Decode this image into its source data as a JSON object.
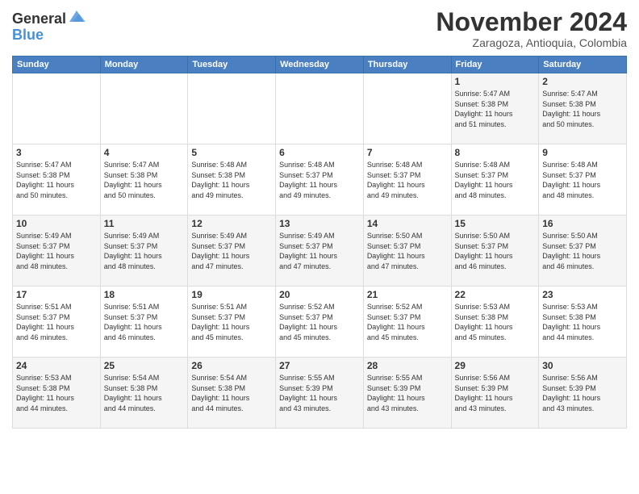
{
  "logo": {
    "line1": "General",
    "line2": "Blue"
  },
  "title": "November 2024",
  "location": "Zaragoza, Antioquia, Colombia",
  "weekdays": [
    "Sunday",
    "Monday",
    "Tuesday",
    "Wednesday",
    "Thursday",
    "Friday",
    "Saturday"
  ],
  "weeks": [
    [
      {
        "day": "",
        "info": ""
      },
      {
        "day": "",
        "info": ""
      },
      {
        "day": "",
        "info": ""
      },
      {
        "day": "",
        "info": ""
      },
      {
        "day": "",
        "info": ""
      },
      {
        "day": "1",
        "info": "Sunrise: 5:47 AM\nSunset: 5:38 PM\nDaylight: 11 hours\nand 51 minutes."
      },
      {
        "day": "2",
        "info": "Sunrise: 5:47 AM\nSunset: 5:38 PM\nDaylight: 11 hours\nand 50 minutes."
      }
    ],
    [
      {
        "day": "3",
        "info": "Sunrise: 5:47 AM\nSunset: 5:38 PM\nDaylight: 11 hours\nand 50 minutes."
      },
      {
        "day": "4",
        "info": "Sunrise: 5:47 AM\nSunset: 5:38 PM\nDaylight: 11 hours\nand 50 minutes."
      },
      {
        "day": "5",
        "info": "Sunrise: 5:48 AM\nSunset: 5:38 PM\nDaylight: 11 hours\nand 49 minutes."
      },
      {
        "day": "6",
        "info": "Sunrise: 5:48 AM\nSunset: 5:37 PM\nDaylight: 11 hours\nand 49 minutes."
      },
      {
        "day": "7",
        "info": "Sunrise: 5:48 AM\nSunset: 5:37 PM\nDaylight: 11 hours\nand 49 minutes."
      },
      {
        "day": "8",
        "info": "Sunrise: 5:48 AM\nSunset: 5:37 PM\nDaylight: 11 hours\nand 48 minutes."
      },
      {
        "day": "9",
        "info": "Sunrise: 5:48 AM\nSunset: 5:37 PM\nDaylight: 11 hours\nand 48 minutes."
      }
    ],
    [
      {
        "day": "10",
        "info": "Sunrise: 5:49 AM\nSunset: 5:37 PM\nDaylight: 11 hours\nand 48 minutes."
      },
      {
        "day": "11",
        "info": "Sunrise: 5:49 AM\nSunset: 5:37 PM\nDaylight: 11 hours\nand 48 minutes."
      },
      {
        "day": "12",
        "info": "Sunrise: 5:49 AM\nSunset: 5:37 PM\nDaylight: 11 hours\nand 47 minutes."
      },
      {
        "day": "13",
        "info": "Sunrise: 5:49 AM\nSunset: 5:37 PM\nDaylight: 11 hours\nand 47 minutes."
      },
      {
        "day": "14",
        "info": "Sunrise: 5:50 AM\nSunset: 5:37 PM\nDaylight: 11 hours\nand 47 minutes."
      },
      {
        "day": "15",
        "info": "Sunrise: 5:50 AM\nSunset: 5:37 PM\nDaylight: 11 hours\nand 46 minutes."
      },
      {
        "day": "16",
        "info": "Sunrise: 5:50 AM\nSunset: 5:37 PM\nDaylight: 11 hours\nand 46 minutes."
      }
    ],
    [
      {
        "day": "17",
        "info": "Sunrise: 5:51 AM\nSunset: 5:37 PM\nDaylight: 11 hours\nand 46 minutes."
      },
      {
        "day": "18",
        "info": "Sunrise: 5:51 AM\nSunset: 5:37 PM\nDaylight: 11 hours\nand 46 minutes."
      },
      {
        "day": "19",
        "info": "Sunrise: 5:51 AM\nSunset: 5:37 PM\nDaylight: 11 hours\nand 45 minutes."
      },
      {
        "day": "20",
        "info": "Sunrise: 5:52 AM\nSunset: 5:37 PM\nDaylight: 11 hours\nand 45 minutes."
      },
      {
        "day": "21",
        "info": "Sunrise: 5:52 AM\nSunset: 5:37 PM\nDaylight: 11 hours\nand 45 minutes."
      },
      {
        "day": "22",
        "info": "Sunrise: 5:53 AM\nSunset: 5:38 PM\nDaylight: 11 hours\nand 45 minutes."
      },
      {
        "day": "23",
        "info": "Sunrise: 5:53 AM\nSunset: 5:38 PM\nDaylight: 11 hours\nand 44 minutes."
      }
    ],
    [
      {
        "day": "24",
        "info": "Sunrise: 5:53 AM\nSunset: 5:38 PM\nDaylight: 11 hours\nand 44 minutes."
      },
      {
        "day": "25",
        "info": "Sunrise: 5:54 AM\nSunset: 5:38 PM\nDaylight: 11 hours\nand 44 minutes."
      },
      {
        "day": "26",
        "info": "Sunrise: 5:54 AM\nSunset: 5:38 PM\nDaylight: 11 hours\nand 44 minutes."
      },
      {
        "day": "27",
        "info": "Sunrise: 5:55 AM\nSunset: 5:39 PM\nDaylight: 11 hours\nand 43 minutes."
      },
      {
        "day": "28",
        "info": "Sunrise: 5:55 AM\nSunset: 5:39 PM\nDaylight: 11 hours\nand 43 minutes."
      },
      {
        "day": "29",
        "info": "Sunrise: 5:56 AM\nSunset: 5:39 PM\nDaylight: 11 hours\nand 43 minutes."
      },
      {
        "day": "30",
        "info": "Sunrise: 5:56 AM\nSunset: 5:39 PM\nDaylight: 11 hours\nand 43 minutes."
      }
    ]
  ]
}
